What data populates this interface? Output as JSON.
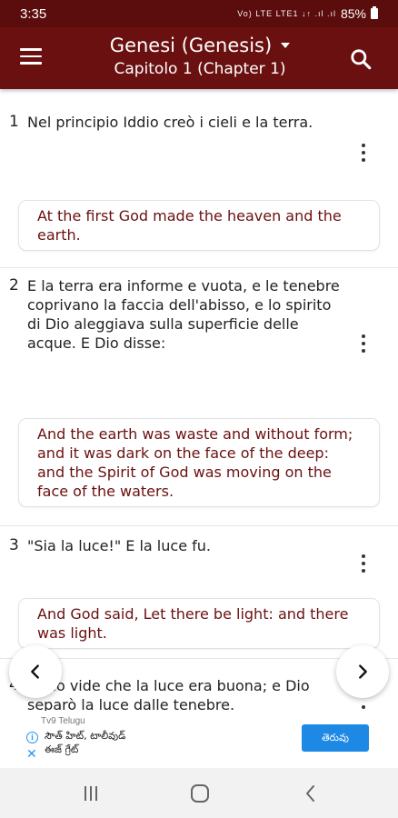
{
  "status_bar": {
    "time": "3:35",
    "network": "Vo) LTE LTE1 ↓↑ .ıl .ıl",
    "battery_percent": "85%"
  },
  "app_bar": {
    "book_title": "Genesi (Genesis)",
    "chapter_title": "Capitolo 1 (Chapter 1)",
    "menu_icon": "hamburger-menu-icon",
    "search_icon": "search-icon",
    "dropdown_icon": "dropdown-arrow-icon"
  },
  "verses": [
    {
      "number": "1",
      "text": "Nel principio Iddio creò i cieli e la terra.",
      "translation": "At the first God made the heaven and the earth."
    },
    {
      "number": "2",
      "text": "E la terra era informe e vuota, e le tenebre coprivano la faccia dell'abisso, e lo spirito di Dio aleggiava sulla superficie delle acque. E Dio disse:",
      "translation": "And the earth was waste and without form; and it was dark on the face of the deep: and the Spirit of God was moving on the face of the waters."
    },
    {
      "number": "3",
      "text": "\"Sia la luce!\" E la luce fu.",
      "translation": "And God said, Let there be light: and there was light."
    },
    {
      "number": "4",
      "text": "E Dio vide che la luce era buona; e Dio separò la luce dalle tenebre.",
      "translation": ""
    }
  ],
  "nav": {
    "prev_icon": "chevron-left-icon",
    "next_icon": "chevron-right-icon"
  },
  "ad": {
    "source": "Tv9 Telugu",
    "line1": "సౌత్ హిట్, టాలీవుడ్",
    "line2": "ఈజ్ గ్రేట్",
    "cta": "తెరువు"
  },
  "colors": {
    "app_bar": "#6b1010",
    "status_bar": "#5b0d0d",
    "translation_text": "#6b1010",
    "ad_button": "#1e88e5"
  }
}
